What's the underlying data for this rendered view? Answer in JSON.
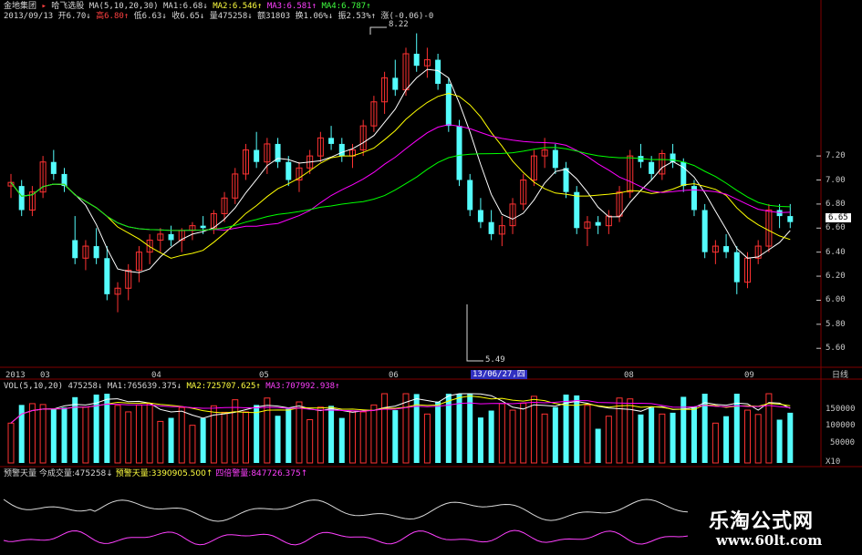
{
  "header": {
    "stock_name": "金地集团",
    "formula_name": "哈飞选股",
    "ma_params": "MA(5,10,20,30)",
    "ma1": "MA1:6.68",
    "ma2": "MA2:6.546",
    "ma3": "MA3:6.581",
    "ma4": "MA4:6.787",
    "date": "2013/09/13",
    "open": "开6.70",
    "high": "高6.80",
    "low": "低6.63",
    "close": "收6.65",
    "volume": "量475258",
    "amount": "额31803",
    "turnover": "换1.06%",
    "amplitude": "振2.53%",
    "change": "涨(-0.06)-0"
  },
  "price_axis": [
    "7.20",
    "7.00",
    "6.80",
    "6.60",
    "6.40",
    "6.20",
    "6.00",
    "5.80",
    "5.60"
  ],
  "current_price_tag": "6.65",
  "high_marker": "8.22",
  "low_marker": "5.49",
  "time_axis": {
    "labels": [
      "2013",
      "03",
      "04",
      "05",
      "06",
      "08",
      "09"
    ],
    "cursor_date": "13/06/27,四",
    "period": "日线"
  },
  "volume_header": {
    "params": "VOL(5,10,20)",
    "value": "475258",
    "ma1": "MA1:765639.375",
    "ma2": "MA2:725707.625",
    "ma3": "MA3:707992.938"
  },
  "volume_axis": [
    "150000",
    "100000",
    "50000",
    "X10"
  ],
  "indicator_header": {
    "name": "预警天量",
    "today_vol": "今成交量:475258",
    "warn": "预警天量:3390905.500",
    "four_warn": "四倍警量:847726.375"
  },
  "watermark": {
    "title": "乐淘公式网",
    "url": "www.60lt.com"
  },
  "colors": {
    "background": "#000000",
    "up_candle": "#ff3232",
    "down_candle": "#54fcfc",
    "ma1": "#ffffff",
    "ma2": "#ffff00",
    "ma3": "#ff00ff",
    "ma4": "#00ff00",
    "grid": "#800000"
  },
  "chart_data": {
    "type": "candlestick",
    "y_axis_range": [
      5.45,
      8.3
    ],
    "candles": [
      [
        6.95,
        7.05,
        6.85,
        6.98
      ],
      [
        6.95,
        7.0,
        6.7,
        6.75
      ],
      [
        6.75,
        6.95,
        6.7,
        6.9
      ],
      [
        6.9,
        7.2,
        6.85,
        7.15
      ],
      [
        7.15,
        7.25,
        7.0,
        7.05
      ],
      [
        7.05,
        7.1,
        6.9,
        6.95
      ],
      [
        6.5,
        6.7,
        6.3,
        6.35
      ],
      [
        6.35,
        6.5,
        6.25,
        6.45
      ],
      [
        6.45,
        6.6,
        6.3,
        6.35
      ],
      [
        6.35,
        6.45,
        6.0,
        6.05
      ],
      [
        6.05,
        6.15,
        5.9,
        6.1
      ],
      [
        6.1,
        6.3,
        6.0,
        6.25
      ],
      [
        6.25,
        6.45,
        6.15,
        6.4
      ],
      [
        6.4,
        6.55,
        6.3,
        6.5
      ],
      [
        6.5,
        6.6,
        6.4,
        6.55
      ],
      [
        6.55,
        6.62,
        6.45,
        6.5
      ],
      [
        6.5,
        6.6,
        6.4,
        6.58
      ],
      [
        6.58,
        6.65,
        6.5,
        6.62
      ],
      [
        6.62,
        6.7,
        6.55,
        6.6
      ],
      [
        6.6,
        6.75,
        6.55,
        6.72
      ],
      [
        6.72,
        6.9,
        6.65,
        6.85
      ],
      [
        6.85,
        7.1,
        6.8,
        7.05
      ],
      [
        7.05,
        7.3,
        7.0,
        7.25
      ],
      [
        7.25,
        7.4,
        7.1,
        7.15
      ],
      [
        7.15,
        7.35,
        7.05,
        7.3
      ],
      [
        7.3,
        7.35,
        7.1,
        7.15
      ],
      [
        7.15,
        7.2,
        6.95,
        7.0
      ],
      [
        7.0,
        7.15,
        6.9,
        7.1
      ],
      [
        7.1,
        7.25,
        7.05,
        7.2
      ],
      [
        7.2,
        7.4,
        7.15,
        7.35
      ],
      [
        7.35,
        7.45,
        7.25,
        7.3
      ],
      [
        7.3,
        7.35,
        7.15,
        7.2
      ],
      [
        7.2,
        7.3,
        7.1,
        7.25
      ],
      [
        7.25,
        7.5,
        7.2,
        7.45
      ],
      [
        7.45,
        7.7,
        7.4,
        7.65
      ],
      [
        7.65,
        7.9,
        7.55,
        7.85
      ],
      [
        7.85,
        8.0,
        7.7,
        7.75
      ],
      [
        7.75,
        8.1,
        7.7,
        8.05
      ],
      [
        8.05,
        8.22,
        7.9,
        7.95
      ],
      [
        7.95,
        8.1,
        7.85,
        8.0
      ],
      [
        8.0,
        8.05,
        7.75,
        7.8
      ],
      [
        7.8,
        7.85,
        7.4,
        7.45
      ],
      [
        7.45,
        7.5,
        6.95,
        7.0
      ],
      [
        7.0,
        7.05,
        6.7,
        6.75
      ],
      [
        6.75,
        6.85,
        6.6,
        6.65
      ],
      [
        6.65,
        6.75,
        6.5,
        6.55
      ],
      [
        6.55,
        6.7,
        6.45,
        6.62
      ],
      [
        6.62,
        6.85,
        6.55,
        6.8
      ],
      [
        6.8,
        7.05,
        6.75,
        7.0
      ],
      [
        7.0,
        7.25,
        6.95,
        7.2
      ],
      [
        7.2,
        7.35,
        7.1,
        7.25
      ],
      [
        7.25,
        7.3,
        7.05,
        7.1
      ],
      [
        7.1,
        7.15,
        6.85,
        6.9
      ],
      [
        6.9,
        6.95,
        6.55,
        6.6
      ],
      [
        6.6,
        6.7,
        6.45,
        6.65
      ],
      [
        6.65,
        6.7,
        6.55,
        6.62
      ],
      [
        6.62,
        6.75,
        6.55,
        6.7
      ],
      [
        6.7,
        6.95,
        6.65,
        6.9
      ],
      [
        6.9,
        7.25,
        6.85,
        7.2
      ],
      [
        7.2,
        7.3,
        7.1,
        7.15
      ],
      [
        7.15,
        7.2,
        7.0,
        7.05
      ],
      [
        7.05,
        7.25,
        7.0,
        7.22
      ],
      [
        7.22,
        7.3,
        7.1,
        7.15
      ],
      [
        7.15,
        7.18,
        6.9,
        6.95
      ],
      [
        6.95,
        7.0,
        6.7,
        6.75
      ],
      [
        6.75,
        6.8,
        6.35,
        6.4
      ],
      [
        6.4,
        6.5,
        6.3,
        6.45
      ],
      [
        6.45,
        6.55,
        6.35,
        6.4
      ],
      [
        6.4,
        6.45,
        6.05,
        6.15
      ],
      [
        6.15,
        6.4,
        6.1,
        6.35
      ],
      [
        6.35,
        6.5,
        6.3,
        6.45
      ],
      [
        6.45,
        6.8,
        6.4,
        6.75
      ],
      [
        6.75,
        6.8,
        6.6,
        6.7
      ],
      [
        6.7,
        6.8,
        6.6,
        6.65
      ]
    ]
  }
}
